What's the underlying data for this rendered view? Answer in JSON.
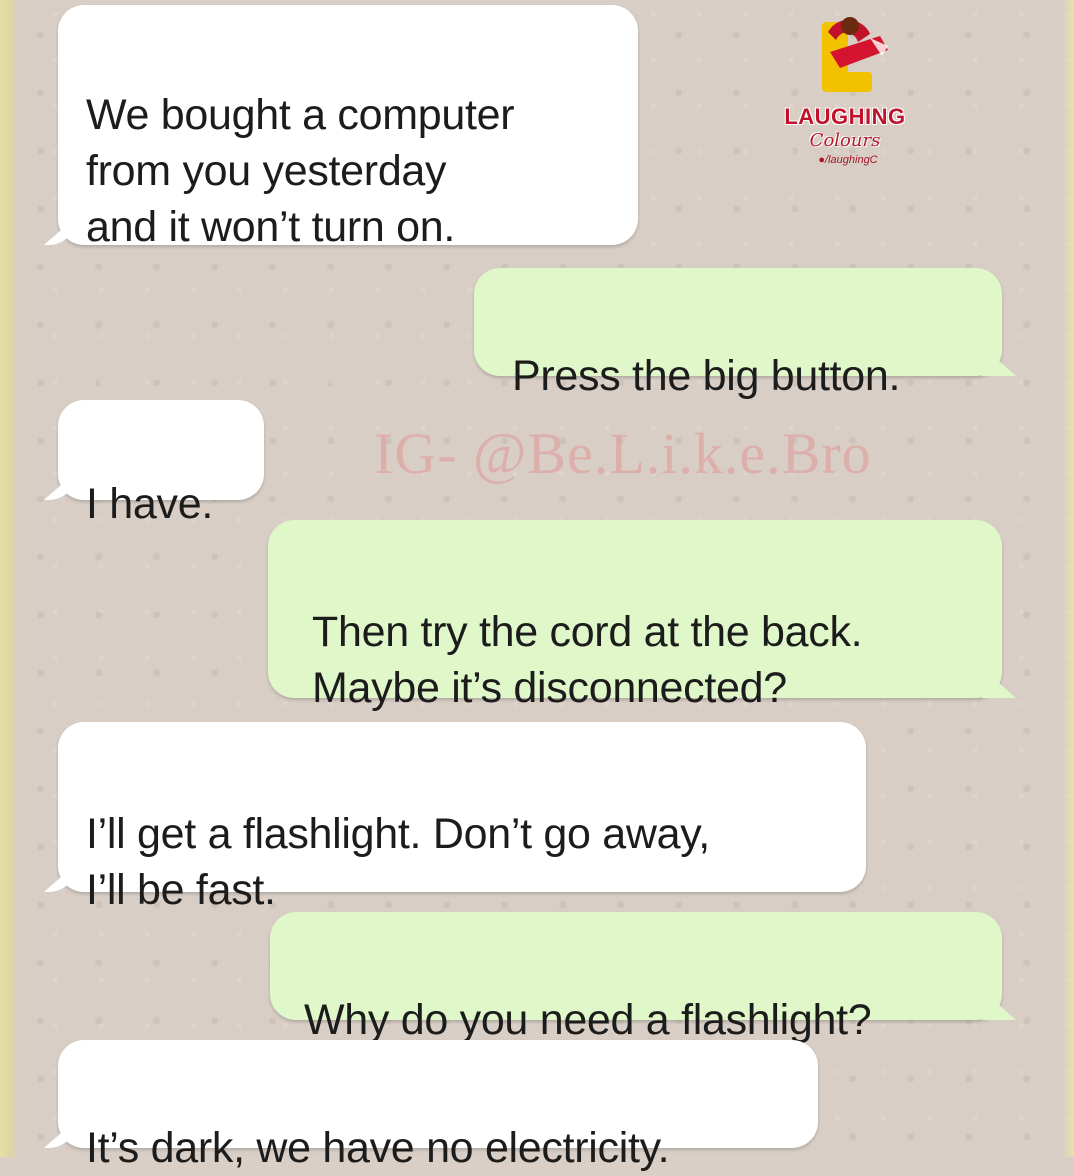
{
  "branding": {
    "logo_title": "LAUGHING",
    "logo_subtitle": "Colours",
    "logo_handle": "/laughingC",
    "watermark": "IG- @Be.L.i.k.e.Bro"
  },
  "messages": [
    {
      "direction": "incoming",
      "text": "We bought a computer\nfrom you yesterday\nand it won’t turn on."
    },
    {
      "direction": "outgoing",
      "text": "Press the big button."
    },
    {
      "direction": "incoming",
      "text": "I have."
    },
    {
      "direction": "outgoing",
      "text": "Then try the cord at the back.\nMaybe it’s disconnected?"
    },
    {
      "direction": "incoming",
      "text": "I’ll get a flashlight. Don’t go away,\nI’ll be fast."
    },
    {
      "direction": "outgoing",
      "text": "Why do you need a flashlight?"
    },
    {
      "direction": "incoming",
      "text": "It’s dark, we have no electricity."
    }
  ],
  "colors": {
    "incoming_bubble": "#ffffff",
    "outgoing_bubble": "#dff7c9",
    "chat_background": "#d8cec5",
    "logo_red": "#c0122b",
    "logo_yellow": "#f2c200"
  }
}
